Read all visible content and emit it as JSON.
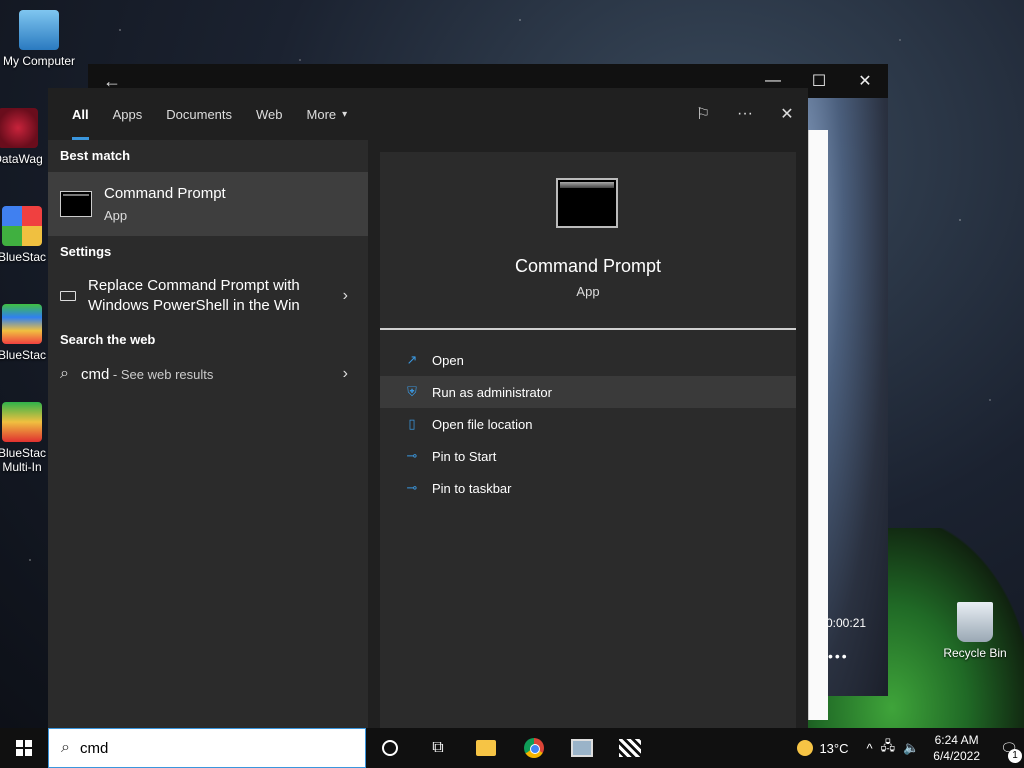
{
  "desktop": {
    "icons": [
      {
        "label": "My Computer"
      },
      {
        "label": "DataWag"
      },
      {
        "label": "BlueStac"
      },
      {
        "label": "BlueStac"
      },
      {
        "label": "BlueStac Multi-In"
      },
      {
        "label": "Recycle Bin"
      }
    ]
  },
  "bg_window": {
    "back": "←",
    "minimize": "—",
    "maximize": "☐",
    "close": "✕",
    "time": "0:00:21",
    "dots": "•••"
  },
  "search": {
    "tabs": [
      {
        "label": "All"
      },
      {
        "label": "Apps"
      },
      {
        "label": "Documents"
      },
      {
        "label": "Web"
      },
      {
        "label": "More"
      }
    ],
    "more_caret": "▾",
    "feedback_icon": "⚐",
    "options_icon": "···",
    "close_icon": "✕",
    "best_match_header": "Best match",
    "best_match": {
      "title": "Command Prompt",
      "subtitle": "App"
    },
    "settings_header": "Settings",
    "setting_item": "Replace Command Prompt with Windows PowerShell in the Win",
    "web_header": "Search the web",
    "web_item": {
      "query": "cmd",
      "hint": " - See web results"
    },
    "chevron": "›",
    "detail": {
      "title": "Command Prompt",
      "subtitle": "App",
      "actions": [
        {
          "label": "Open",
          "icon": "↗"
        },
        {
          "label": "Run as administrator",
          "icon": "⛨"
        },
        {
          "label": "Open file location",
          "icon": "▯"
        },
        {
          "label": "Pin to Start",
          "icon": "⊸"
        },
        {
          "label": "Pin to taskbar",
          "icon": "⊸"
        }
      ]
    }
  },
  "taskbar": {
    "search_value": "cmd",
    "search_icon": "⌕",
    "task_view_icon": "⧉",
    "temperature": "13°C",
    "tray_chevron": "^",
    "network_icon": "🖧",
    "volume_icon": "🔈",
    "time": "6:24 AM",
    "date": "6/4/2022",
    "notif_icon": "🗨",
    "notif_count": "1"
  }
}
